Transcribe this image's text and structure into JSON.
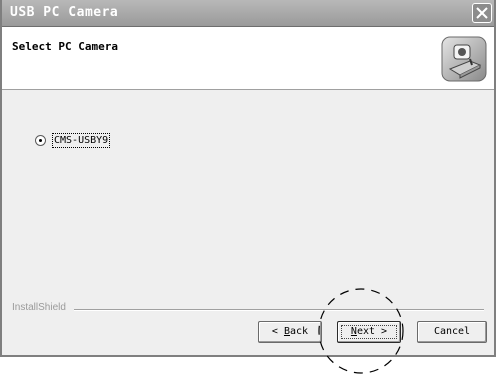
{
  "window": {
    "title": "USB PC Camera"
  },
  "header": {
    "title": "Select PC Camera",
    "logo_icon": "camera-setup-icon"
  },
  "options": [
    {
      "label": "CMS-USBY9",
      "selected": true
    }
  ],
  "footer": {
    "brand": "InstallShield",
    "back_label_prefix": "< ",
    "back_label_access": "B",
    "back_label_rest": "ack",
    "next_label_access": "N",
    "next_label_rest": "ext >",
    "cancel_label": "Cancel"
  },
  "colors": {
    "titlebar": "#9a9a9a",
    "dialog_bg": "#efefef",
    "header_bg": "#ffffff"
  }
}
